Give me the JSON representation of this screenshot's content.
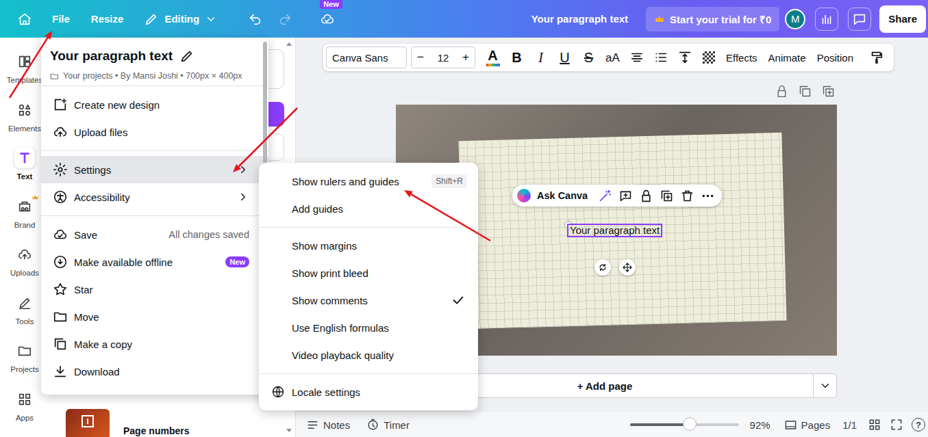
{
  "topbar": {
    "file": "File",
    "resize": "Resize",
    "editing": "Editing",
    "undo": {
      "disabled": false
    },
    "redo": {
      "disabled": true
    },
    "new_badge": "New",
    "doc_title": "Your paragraph text",
    "trial": "Start your trial for ₹0",
    "avatar": "M",
    "share": "Share"
  },
  "sidebar": {
    "items": [
      {
        "label": "Templates",
        "selected": false
      },
      {
        "label": "Elements",
        "selected": false
      },
      {
        "label": "Text",
        "selected": true
      },
      {
        "label": "Brand",
        "selected": false
      },
      {
        "label": "Uploads",
        "selected": false
      },
      {
        "label": "Tools",
        "selected": false
      },
      {
        "label": "Projects",
        "selected": false
      },
      {
        "label": "Apps",
        "selected": false
      }
    ]
  },
  "panel": {
    "visible_item": "Page numbers"
  },
  "toolbar": {
    "font": "Canva Sans",
    "minus": "−",
    "size": "12",
    "plus": "+",
    "format": [
      {
        "label": "A",
        "kind": "color"
      },
      {
        "label": "B",
        "kind": "bold"
      },
      {
        "label": "I",
        "kind": "italic"
      },
      {
        "label": "U",
        "kind": "underline"
      },
      {
        "label": "S",
        "kind": "strike"
      },
      {
        "label": "aA",
        "kind": "case"
      }
    ],
    "actions": [
      "Effects",
      "Animate",
      "Position"
    ]
  },
  "canvas": {
    "text_element": "Your paragraph text",
    "ask_canva": "Ask Canva",
    "add_page": "+ Add page"
  },
  "bottom_bar": {
    "notes": "Notes",
    "timer": "Timer",
    "zoom_level": 0.55,
    "zoom": "92%",
    "pages": "Pages",
    "page_count": "1/1",
    "help": "?"
  },
  "file_menu": {
    "title": "Your paragraph text",
    "meta": "Your projects • By Mansi Joshi • 700px × 400px",
    "groups": [
      [
        {
          "label": "Create new design",
          "selected": false,
          "submenu": false
        },
        {
          "label": "Upload files",
          "selected": false,
          "submenu": false
        }
      ],
      [
        {
          "label": "Settings",
          "selected": true,
          "submenu": true
        },
        {
          "label": "Accessibility",
          "selected": false,
          "submenu": true
        }
      ],
      [
        {
          "label": "Save",
          "selected": false,
          "submenu": false,
          "note": "All changes saved"
        },
        {
          "label": "Make available offline",
          "selected": false,
          "submenu": false,
          "badge": "New"
        },
        {
          "label": "Star",
          "selected": false,
          "submenu": false
        },
        {
          "label": "Move",
          "selected": false,
          "submenu": false
        },
        {
          "label": "Make a copy",
          "selected": false,
          "submenu": false
        },
        {
          "label": "Download",
          "selected": false,
          "submenu": false
        }
      ]
    ]
  },
  "settings_menu": {
    "groups": [
      [
        {
          "label": "Show rulers and guides",
          "shortcut": "Shift+R",
          "checked": false
        },
        {
          "label": "Add guides",
          "checked": false
        }
      ],
      [
        {
          "label": "Show margins",
          "checked": false
        },
        {
          "label": "Show print bleed",
          "checked": false
        },
        {
          "label": "Show comments",
          "checked": true
        },
        {
          "label": "Use English formulas",
          "checked": false
        },
        {
          "label": "Video playback quality",
          "checked": false
        }
      ],
      [
        {
          "label": "Locale settings",
          "checked": false
        }
      ]
    ]
  }
}
